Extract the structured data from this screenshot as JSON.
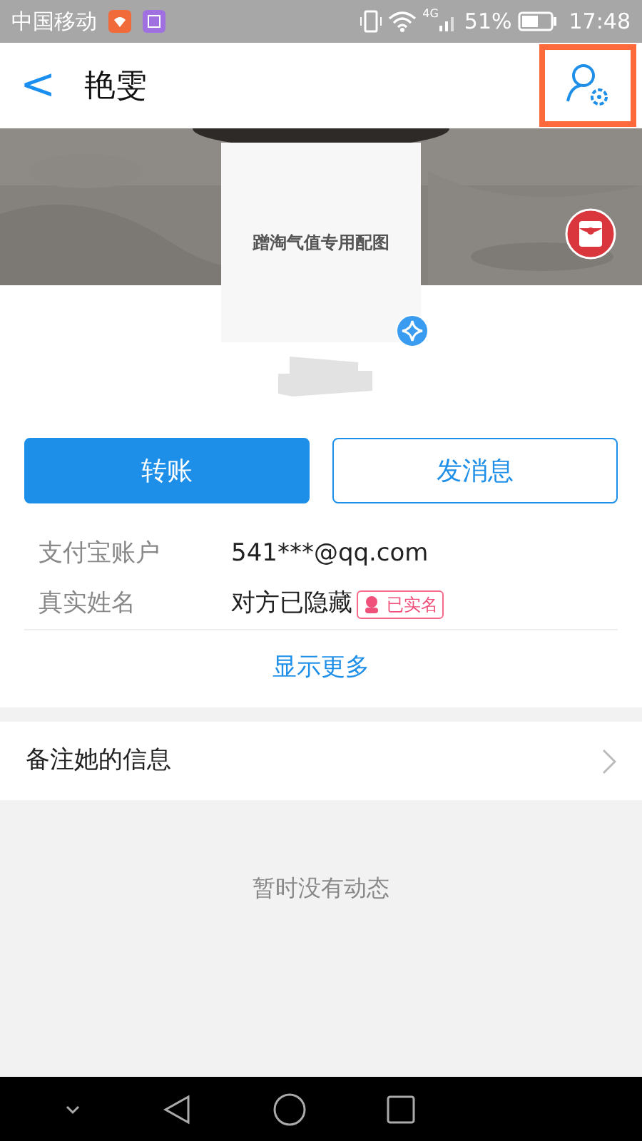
{
  "status_bar": {
    "carrier": "中国移动",
    "network": "4G",
    "battery": "51%",
    "time": "17:48"
  },
  "header": {
    "back": "<",
    "title": "艳雯",
    "settings_highlighted": true
  },
  "profile": {
    "avatar_text": "蹭淘气值专用配图",
    "name_hidden": true
  },
  "buttons": [
    {
      "label": "转账",
      "kind": "primary"
    },
    {
      "label": "发消息",
      "kind": "outline"
    }
  ],
  "info": [
    {
      "label": "支付宝账户",
      "value": "541***@qq.com"
    },
    {
      "label": "真实姓名",
      "value": "对方已隐藏",
      "tag": "已实名"
    }
  ],
  "show_more": "显示更多",
  "remark": {
    "label": "备注她的信息"
  },
  "feed_empty": "暂时没有动态"
}
